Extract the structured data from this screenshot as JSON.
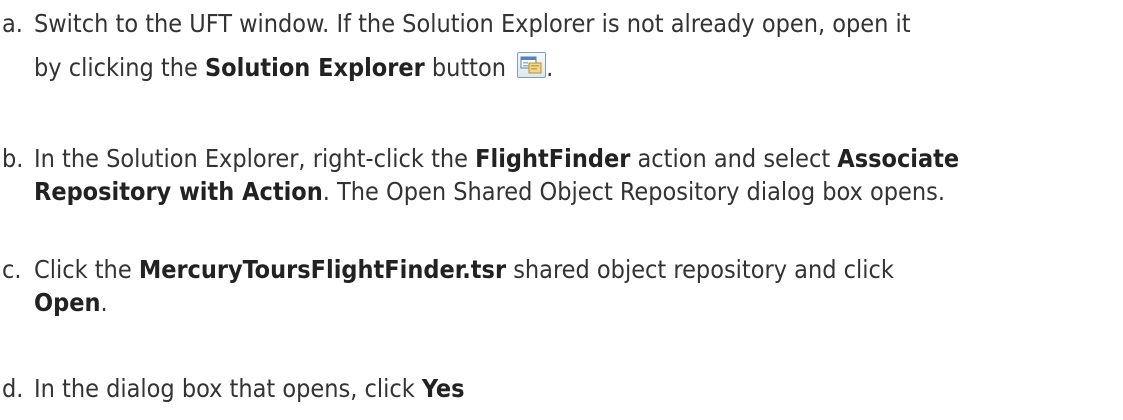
{
  "steps": [
    {
      "marker": "a.",
      "lines": [
        [
          {
            "text": "Switch to the UFT window. If the Solution Explorer is not already open, open it"
          }
        ],
        [
          {
            "text": "by clicking the "
          },
          {
            "text": "Solution Explorer",
            "bold": true
          },
          {
            "text": " button "
          },
          {
            "icon": "solution-explorer-icon"
          },
          {
            "text": "."
          }
        ]
      ]
    },
    {
      "marker": "b.",
      "lines": [
        [
          {
            "text": "In the Solution Explorer, right-click the "
          },
          {
            "text": "FlightFinder",
            "bold": true
          },
          {
            "text": " action and select "
          },
          {
            "text": "Associate",
            "bold": true
          }
        ],
        [
          {
            "text": "Repository with Action",
            "bold": true
          },
          {
            "text": ". The Open Shared Object Repository dialog box opens."
          }
        ]
      ]
    },
    {
      "marker": "c.",
      "lines": [
        [
          {
            "text": "Click the "
          },
          {
            "text": "MercuryToursFlightFinder.tsr",
            "bold": true
          },
          {
            "text": " shared object repository and click"
          }
        ],
        [
          {
            "text": "Open",
            "bold": true
          },
          {
            "text": "."
          }
        ]
      ]
    },
    {
      "marker": "d.",
      "lines": [
        [
          {
            "text": "In the dialog box that opens, click "
          },
          {
            "text": "Yes",
            "bold": true
          }
        ]
      ]
    }
  ]
}
